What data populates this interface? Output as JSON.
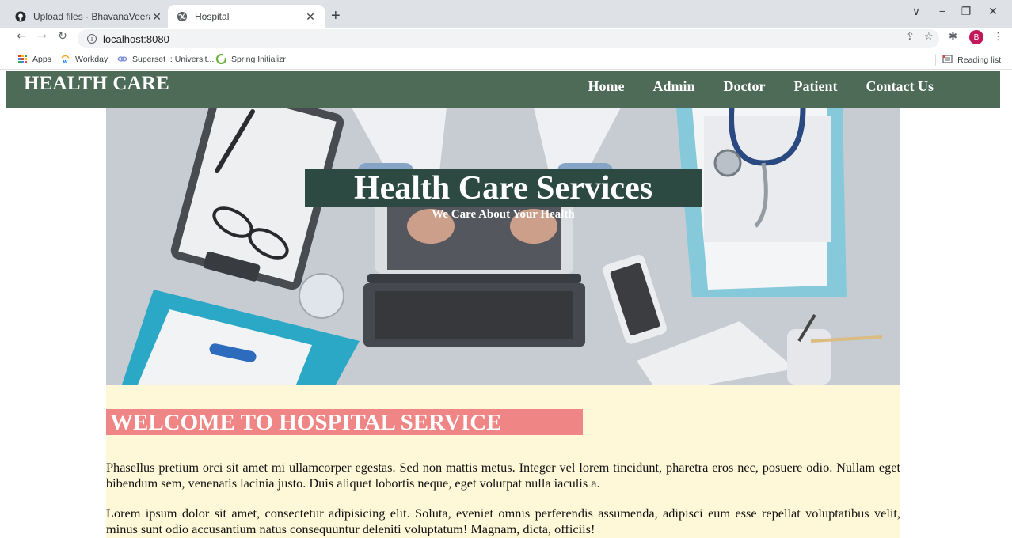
{
  "browser": {
    "tabs": [
      {
        "title": "Upload files · BhavanaVeeranna/F",
        "active": false,
        "icon": "github-icon"
      },
      {
        "title": "Hospital",
        "active": true,
        "icon": "globe-icon"
      }
    ],
    "new_tab": "+",
    "window_controls": [
      "∨",
      "−",
      "❐",
      "✕"
    ],
    "address": "localhost:8080",
    "profile_initial": "B",
    "bookmarks": [
      {
        "label": "Apps",
        "icon": "apps-grid-icon"
      },
      {
        "label": "Workday",
        "icon": "workday-icon"
      },
      {
        "label": "Superset :: Universit...",
        "icon": "superset-icon"
      },
      {
        "label": "Spring Initializr",
        "icon": "spring-icon"
      }
    ],
    "reading_list": "Reading list"
  },
  "site": {
    "brand": "HEALTH CARE",
    "nav": [
      "Home",
      "Admin",
      "Doctor",
      "Patient",
      "Contact Us"
    ],
    "hero": {
      "title": "Health Care Services",
      "subtitle": "We Care About Your Health"
    },
    "welcome_heading": "WELCOME TO HOSPITAL SERVICE",
    "paragraphs": [
      "Phasellus pretium orci sit amet mi ullamcorper egestas. Sed non mattis metus. Integer vel lorem tincidunt, pharetra eros nec, posuere odio. Nullam eget bibendum sem, venenatis lacinia justo. Duis aliquet lobortis neque, eget volutpat nulla iaculis a.",
      "Lorem ipsum dolor sit amet, consectetur adipisicing elit. Soluta, eveniet omnis perferendis assumenda, adipisci eum esse repellat voluptatibus velit, minus sunt odio accusantium natus consequuntur deleniti voluptatum! Magnam, dicta, officiis!"
    ]
  },
  "colors": {
    "navbar": "#4e6b58",
    "hero_title_bg": "#2c4a42",
    "welcome_bg": "#ef8584",
    "content_bg": "#fff8d8"
  }
}
